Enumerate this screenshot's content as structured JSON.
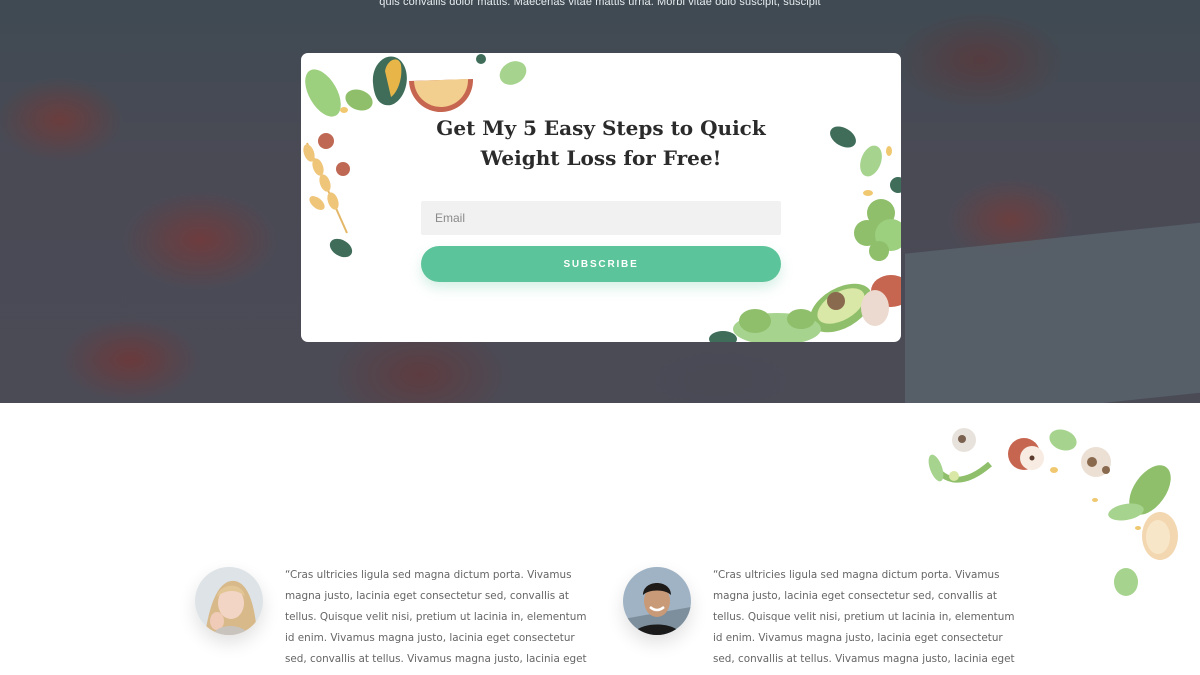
{
  "hero": {
    "top_text": "quis convallis dolor mattis. Maecenas vitae mattis urna. Morbi vitae odio suscipit, suscipit"
  },
  "signup": {
    "title": "Get My 5 Easy Steps to Quick Weight Loss for Free!",
    "email_placeholder": "Email",
    "email_value": "",
    "button_label": "SUBSCRIBE"
  },
  "testimonials": [
    {
      "quote": "“Cras ultricies ligula sed magna dictum porta. Vivamus magna justo, lacinia eget consectetur sed, convallis at tellus. Quisque velit nisi, pretium ut lacinia in, elementum id enim. Vivamus magna justo, lacinia eget consectetur sed, convallis at tellus. Vivamus magna justo, lacinia eget consectetur.”"
    },
    {
      "quote": "“Cras ultricies ligula sed magna dictum porta. Vivamus magna justo, lacinia eget consectetur sed, convallis at tellus. Quisque velit nisi, pretium ut lacinia in, elementum id enim. Vivamus magna justo, lacinia eget consectetur sed, convallis at tellus. Vivamus magna justo, lacinia eget consectetur.”"
    }
  ],
  "colors": {
    "accent": "#5cc49a",
    "hero_overlay": "#4a4a55",
    "card_bg": "#ffffff"
  }
}
